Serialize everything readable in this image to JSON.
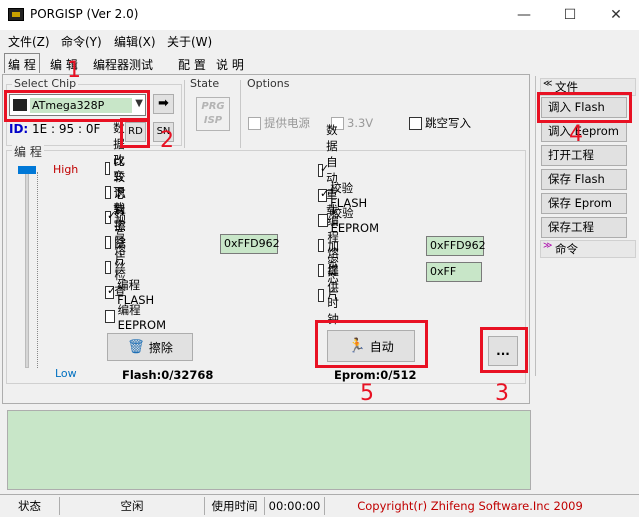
{
  "window": {
    "title": "PORGISP (Ver 2.0)",
    "minimize": "—",
    "maximize": "☐",
    "close": "✕"
  },
  "menu": [
    "文件(Z)",
    "命令(Y)",
    "编辑(X)",
    "关于(W)"
  ],
  "tabs": [
    "编 程",
    "编 辑",
    "编程器测试",
    "配 置",
    "说 明"
  ],
  "chip": {
    "group_label": "Select Chip",
    "selected": "ATmega328P",
    "go_arrow": "➡",
    "id_label": "ID:",
    "id_value": "1E : 95 : 0F",
    "rd_button": "RD",
    "sn_button": "SN"
  },
  "state": {
    "group_label": "State",
    "logo_line1": "PRG",
    "logo_line2": "ISP"
  },
  "options": {
    "group_label": "Options",
    "power": "提供电源",
    "voltage": "3.3V",
    "jump_write": "跳空写入"
  },
  "program": {
    "group_label": "编 程",
    "high": "High",
    "low": "Low",
    "left_options": [
      {
        "label": "数据改变下载",
        "checked": false
      },
      {
        "label": "比较识别字",
        "checked": false
      },
      {
        "label": "芯片擦除",
        "checked": true
      },
      {
        "label": "预写熔丝",
        "checked": false
      },
      {
        "label": "空片检查",
        "checked": false
      },
      {
        "label": "编程 FLASH",
        "checked": true
      },
      {
        "label": "编程 EEPROM",
        "checked": false
      }
    ],
    "right_options": [
      {
        "label": "数据自动重载",
        "checked": true
      },
      {
        "label": "校验 FLASH",
        "checked": true
      },
      {
        "label": "校验 EEPROM",
        "checked": false
      },
      {
        "label": "编程熔丝",
        "checked": false
      },
      {
        "label": "加密芯片",
        "checked": false
      },
      {
        "label": "提供时钟",
        "checked": false
      }
    ],
    "prewrite_fuse_value": "0xFFD962",
    "program_fuse_value": "0xFFD962",
    "lock_value": "0xFF",
    "erase_button": "擦除",
    "auto_button": "自动",
    "more_button": "...",
    "flash_info": "Flash:0/32768",
    "eprom_info": "Eprom:0/512"
  },
  "annotations": [
    "1",
    "2",
    "3",
    "4",
    "5"
  ],
  "sidebar": {
    "file_header": "文件",
    "buttons": [
      "调入 Flash",
      "调入 Eeprom",
      "打开工程",
      "保存 Flash",
      "保存 Eprom",
      "保存工程"
    ],
    "command_header": "命令"
  },
  "status": {
    "state_label": "状态",
    "state_value": "空闲",
    "time_label": "使用时间",
    "time_value": "00:00:00",
    "copyright": "Copyright(r) Zhifeng Software.Inc 2009"
  },
  "colors": {
    "accent_red": "#e81123",
    "field_green": "#c8e6c8",
    "id_blue": "#0000c8"
  }
}
